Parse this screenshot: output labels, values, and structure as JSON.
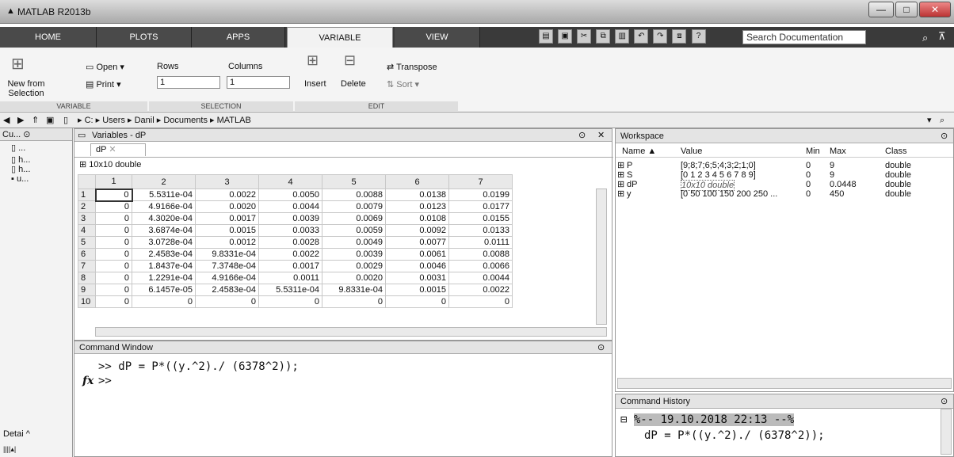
{
  "app": {
    "title": "MATLAB R2013b"
  },
  "tabs": [
    "HOME",
    "PLOTS",
    "APPS",
    "VARIABLE",
    "VIEW"
  ],
  "search": {
    "placeholder": "Search Documentation"
  },
  "ribbon": {
    "new_from_selection": "New from Selection",
    "open": "Open",
    "print": "Print",
    "rows_label": "Rows",
    "columns_label": "Columns",
    "rows_value": "1",
    "columns_value": "1",
    "insert": "Insert",
    "delete": "Delete",
    "transpose": "Transpose",
    "sort": "Sort",
    "sections": [
      "VARIABLE",
      "SELECTION",
      "EDIT"
    ]
  },
  "address": {
    "path": [
      "C:",
      "Users",
      "Danil",
      "Documents",
      "MATLAB"
    ]
  },
  "left": {
    "title": "Cu...",
    "items": [
      "...",
      "h...",
      "h...",
      "u..."
    ],
    "footer": "Detai"
  },
  "variables": {
    "title": "Variables - dP",
    "tab": "dP",
    "info": "10x10 double",
    "columns": [
      "1",
      "2",
      "3",
      "4",
      "5",
      "6",
      "7"
    ],
    "rows": [
      [
        "1",
        "0",
        "5.5311e-04",
        "0.0022",
        "0.0050",
        "0.0088",
        "0.0138",
        "0.0199"
      ],
      [
        "2",
        "0",
        "4.9166e-04",
        "0.0020",
        "0.0044",
        "0.0079",
        "0.0123",
        "0.0177"
      ],
      [
        "3",
        "0",
        "4.3020e-04",
        "0.0017",
        "0.0039",
        "0.0069",
        "0.0108",
        "0.0155"
      ],
      [
        "4",
        "0",
        "3.6874e-04",
        "0.0015",
        "0.0033",
        "0.0059",
        "0.0092",
        "0.0133"
      ],
      [
        "5",
        "0",
        "3.0728e-04",
        "0.0012",
        "0.0028",
        "0.0049",
        "0.0077",
        "0.0111"
      ],
      [
        "6",
        "0",
        "2.4583e-04",
        "9.8331e-04",
        "0.0022",
        "0.0039",
        "0.0061",
        "0.0088"
      ],
      [
        "7",
        "0",
        "1.8437e-04",
        "7.3748e-04",
        "0.0017",
        "0.0029",
        "0.0046",
        "0.0066"
      ],
      [
        "8",
        "0",
        "1.2291e-04",
        "4.9166e-04",
        "0.0011",
        "0.0020",
        "0.0031",
        "0.0044"
      ],
      [
        "9",
        "0",
        "6.1457e-05",
        "2.4583e-04",
        "5.5311e-04",
        "9.8331e-04",
        "0.0015",
        "0.0022"
      ],
      [
        "10",
        "0",
        "0",
        "0",
        "0",
        "0",
        "0",
        "0"
      ]
    ]
  },
  "command": {
    "title": "Command Window",
    "line1": ">> dP = P*((y.^2)./ (6378^2));",
    "prompt": ">>",
    "fx": "fx"
  },
  "workspace": {
    "title": "Workspace",
    "headers": [
      "Name",
      "Value",
      "Min",
      "Max",
      "Class"
    ],
    "rows": [
      [
        "P",
        "[9;8;7;6;5;4;3;2;1;0]",
        "0",
        "9",
        "double"
      ],
      [
        "S",
        "[0 1 2 3 4 5 6 7 8 9]",
        "0",
        "9",
        "double"
      ],
      [
        "dP",
        "10x10 double",
        "0",
        "0.0448",
        "double"
      ],
      [
        "y",
        "[0 50 100 150 200 250 ...",
        "0",
        "450",
        "double"
      ]
    ]
  },
  "history": {
    "title": "Command History",
    "section": "%-- 19.10.2018 22:13 --%",
    "entry": "dP = P*((y.^2)./ (6378^2));"
  }
}
